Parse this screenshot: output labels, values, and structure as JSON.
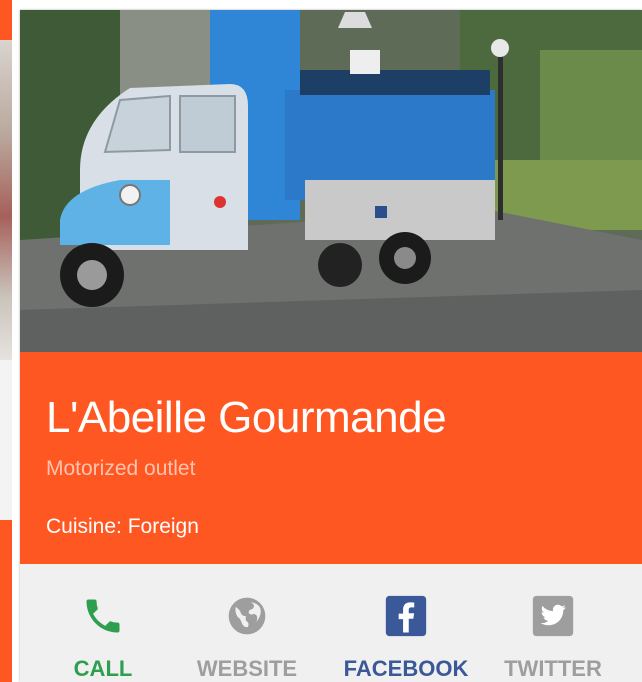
{
  "card": {
    "title": "L'Abeille Gourmande",
    "subtitle": "Motorized outlet",
    "cuisine": "Cuisine: Foreign",
    "photo_alt": "Blue three-wheeled food truck parked in a courtyard"
  },
  "actions": [
    {
      "label": "CALL",
      "icon": "phone-icon",
      "color": "#2e9e4f"
    },
    {
      "label": "WEBSITE",
      "icon": "globe-icon",
      "color": "#9e9e9e"
    },
    {
      "label": "FACEBOOK",
      "icon": "facebook-icon",
      "color": "#3b5998"
    },
    {
      "label": "TWITTER",
      "icon": "twitter-icon",
      "color": "#9e9e9e"
    }
  ],
  "colors": {
    "accent": "#ff5722",
    "action_bar": "#f0f0f0"
  }
}
